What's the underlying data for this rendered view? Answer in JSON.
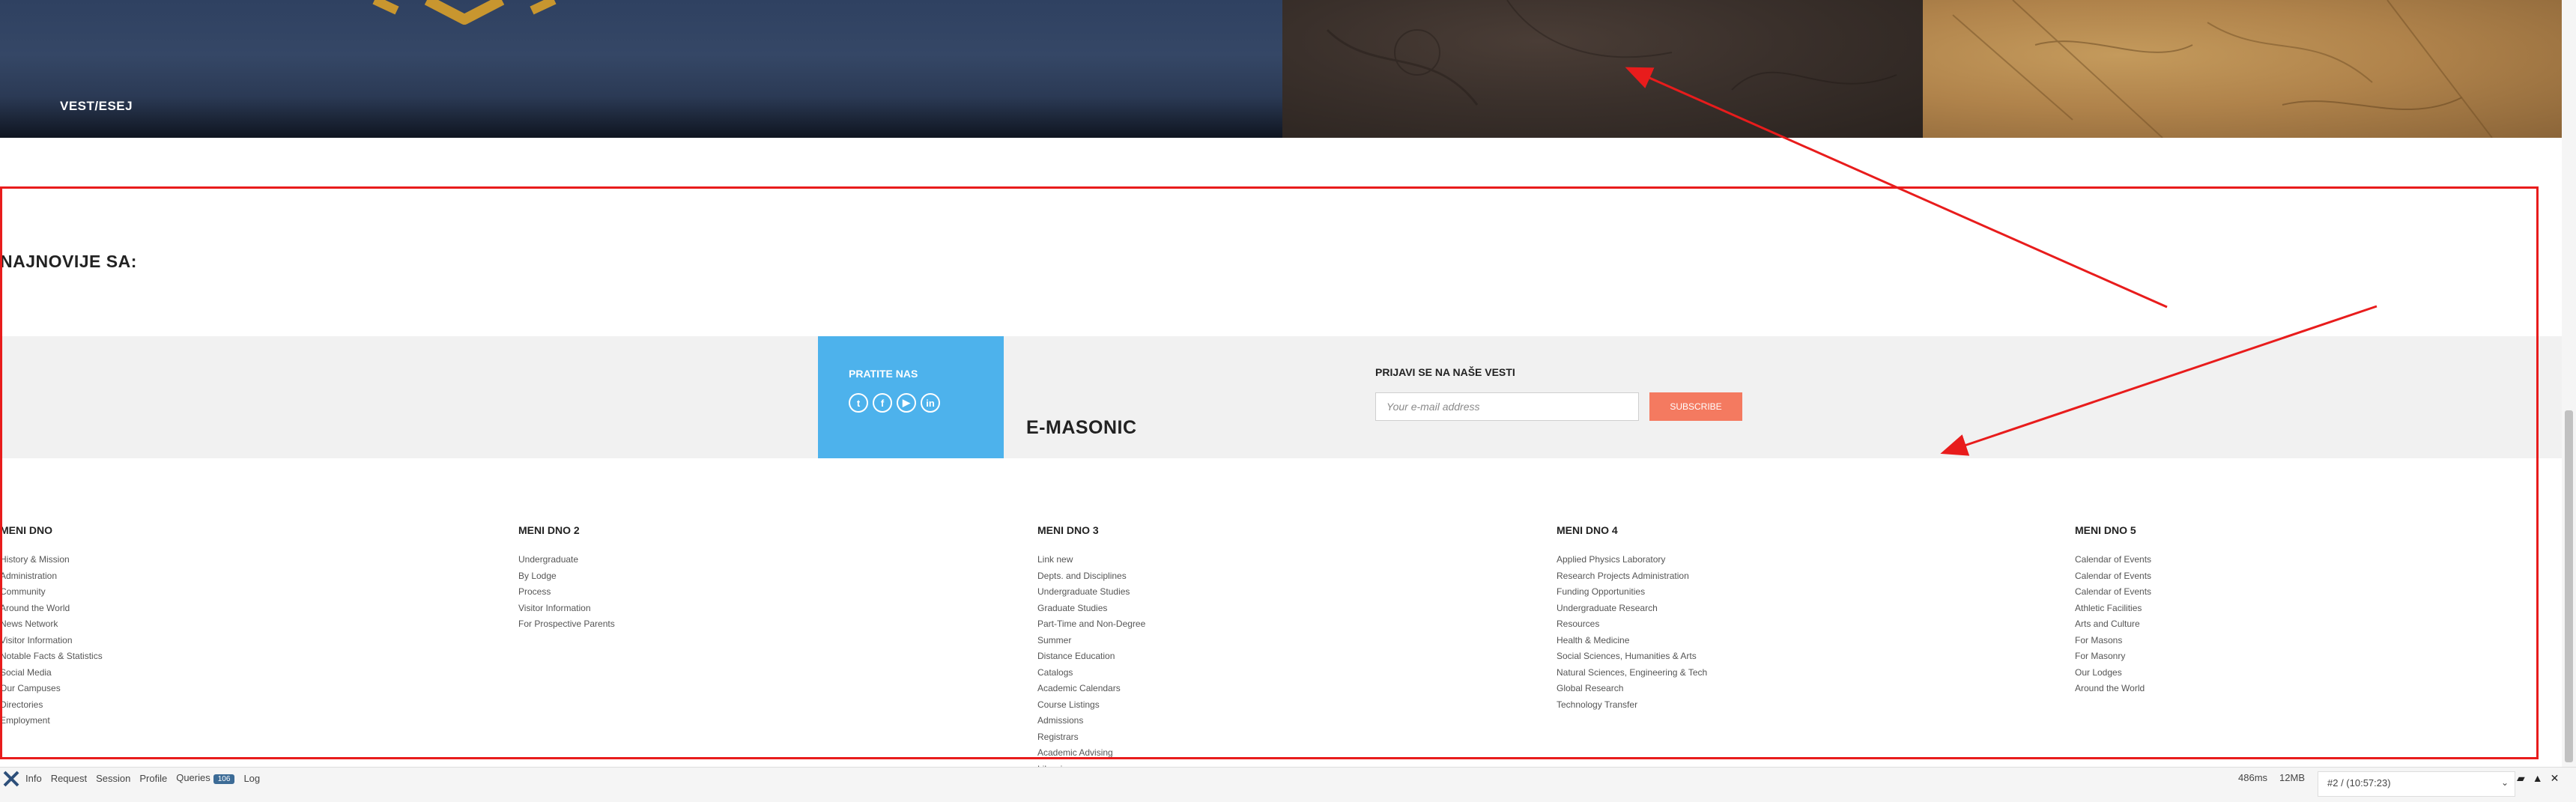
{
  "hero": {
    "caption": "VEST/ESEJ"
  },
  "latest": {
    "heading": "NAJNOVIJE SA:"
  },
  "follow": {
    "title": "PRATITE NAS",
    "icons": [
      "twitter-icon",
      "facebook-icon",
      "youtube-icon",
      "linkedin-icon"
    ]
  },
  "brand": {
    "name": "E-MASONIC"
  },
  "subscribe": {
    "title": "PRIJAVI SE NA NAŠE VESTI",
    "placeholder": "Your e-mail address",
    "button_label": "SUBSCRIBE"
  },
  "menus": [
    {
      "title": "MENI DNO",
      "items": [
        "History & Mission",
        "Administration",
        "Community",
        "Around the World",
        "News Network",
        "Visitor Information",
        "Notable Facts & Statistics",
        "Social Media",
        "Our Campuses",
        "Directories",
        "Employment"
      ]
    },
    {
      "title": "MENI DNO 2",
      "items": [
        "Undergraduate",
        "By Lodge",
        "Process",
        "Visitor Information",
        "For Prospective Parents"
      ]
    },
    {
      "title": "MENI DNO 3",
      "items": [
        "Link new",
        "Depts. and Disciplines",
        "Undergraduate Studies",
        "Graduate Studies",
        "Part-Time and Non-Degree",
        "Summer",
        "Distance Education",
        "Catalogs",
        "Academic Calendars",
        "Course Listings",
        "Admissions",
        "Registrars",
        "Academic Advising",
        "Libraries"
      ]
    },
    {
      "title": "MENI DNO 4",
      "items": [
        "Applied Physics Laboratory",
        "Research Projects Administration",
        "Funding Opportunities",
        "Undergraduate Research",
        "Resources",
        "Health & Medicine",
        "Social Sciences, Humanities & Arts",
        "Natural Sciences, Engineering & Tech",
        "Global Research",
        "Technology Transfer"
      ]
    },
    {
      "title": "MENI DNO 5",
      "items": [
        "Calendar of Events",
        "Calendar of Events",
        "Calendar of Events",
        "Athletic Facilities",
        "Arts and Culture",
        "For Masons",
        "For Masonry",
        "Our Lodges",
        "Around the World"
      ]
    }
  ],
  "debugbar": {
    "items": [
      "Info",
      "Request",
      "Session",
      "Profile",
      "Queries",
      "Log"
    ],
    "queries_count": "106",
    "time": "486ms",
    "memory": "12MB",
    "request_select": "#2 / (10:57:23)"
  },
  "colors": {
    "follow_bg": "#4db2ec",
    "subscribe_button": "#f47a60",
    "annotation": "#e81c1c",
    "band_bg": "#f1f1f1"
  }
}
